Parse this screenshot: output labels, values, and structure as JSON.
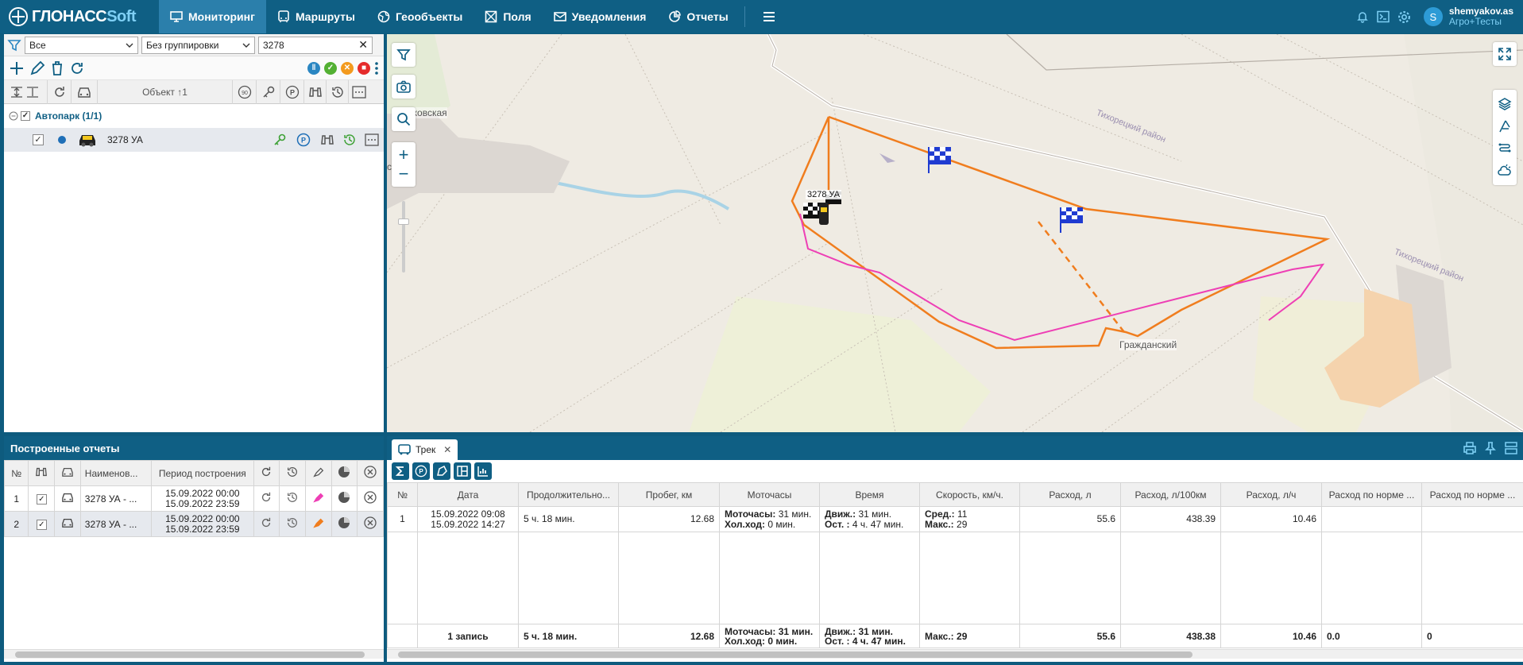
{
  "brand": {
    "name_a": "ГЛОНАСС",
    "name_b": "Soft"
  },
  "nav": [
    {
      "label": "Мониторинг",
      "icon": "monitor-icon",
      "active": true
    },
    {
      "label": "Маршруты",
      "icon": "bus-icon",
      "active": false
    },
    {
      "label": "Геообъекты",
      "icon": "geoobject-icon",
      "active": false
    },
    {
      "label": "Поля",
      "icon": "field-icon",
      "active": false
    },
    {
      "label": "Уведомления",
      "icon": "mail-icon",
      "active": false
    },
    {
      "label": "Отчеты",
      "icon": "reports-icon",
      "active": false
    }
  ],
  "user": {
    "login": "shemyakov.as",
    "org": "Агро+Тесты",
    "initial": "S"
  },
  "filters": {
    "status": "Все",
    "grouping": "Без группировки",
    "search": "3278"
  },
  "objects": {
    "header_object": "Объект ↑1",
    "group": {
      "name": "Автопарк",
      "count": "(1/1)"
    },
    "items": [
      {
        "name": "3278 УА"
      }
    ]
  },
  "reports": {
    "title": "Построенные отчеты",
    "columns": {
      "num": "№",
      "name": "Наименов...",
      "period": "Период построения"
    },
    "rows": [
      {
        "num": "1",
        "name": "3278 УА - ...",
        "from": "15.09.2022 00:00",
        "to": "15.09.2022 23:59"
      },
      {
        "num": "2",
        "name": "3278 УА - ...",
        "from": "15.09.2022 00:00",
        "to": "15.09.2022 23:59"
      }
    ]
  },
  "map": {
    "labels": {
      "village1": "Выжковская",
      "village1b": "ская",
      "village2": "Гражданский",
      "district1": "Тихорецкий район",
      "district2": "Тихорецкий район",
      "vehicle": "3278 УА"
    }
  },
  "track": {
    "tab_label": "Трек",
    "columns": [
      "№",
      "Дата",
      "Продолжительно...",
      "Пробег, км",
      "Моточасы",
      "Время",
      "Скорость, км/ч.",
      "Расход, л",
      "Расход, л/100км",
      "Расход, л/ч",
      "Расход по норме ...",
      "Расход по норме ..."
    ],
    "row": {
      "num": "1",
      "date_from": "15.09.2022 09:08",
      "date_to": "15.09.2022 14:27",
      "duration": "5 ч. 18 мин.",
      "mileage": "12.68",
      "moto_label": "Моточасы:",
      "moto_val": "31 мин.",
      "idle_label": "Хол.ход:",
      "idle_val": "0 мин.",
      "move_label": "Движ.:",
      "move_val": "31 мин.",
      "stop_label": "Ост. :",
      "stop_val": "4 ч. 47 мин.",
      "avg_label": "Сред.:",
      "avg_val": "11",
      "max_label": "Макс.:",
      "max_val": "29",
      "fuel": "55.6",
      "fuel_100": "438.39",
      "fuel_h": "10.46",
      "norm1": "",
      "norm2": ""
    },
    "total": {
      "label": "1 запись",
      "duration": "5 ч. 18 мин.",
      "mileage": "12.68",
      "moto_label": "Моточасы:",
      "moto_val": "31 мин.",
      "idle_label": "Хол.ход:",
      "idle_val": "0 мин.",
      "move_label": "Движ.:",
      "move_val": "31 мин.",
      "stop_label": "Ост. :",
      "stop_val": "4 ч. 47 мин.",
      "max_label": "Макс.:",
      "max_val": "29",
      "fuel": "55.6",
      "fuel_100": "438.38",
      "fuel_h": "10.46",
      "norm1": "0.0",
      "norm2": "0"
    }
  },
  "colors": {
    "brand": "#0f5f84",
    "track_orange": "#f07d1e",
    "track_pink": "#ee3fb5"
  }
}
